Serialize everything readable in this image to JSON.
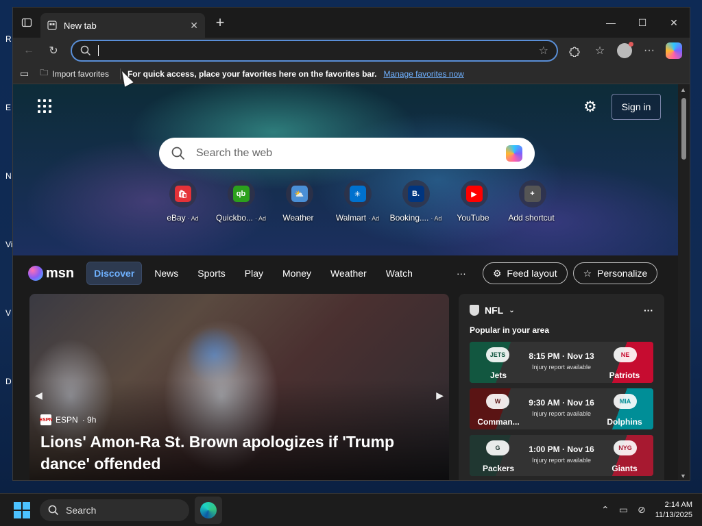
{
  "desktop": {
    "side_letters": [
      "R",
      "E",
      "N",
      "Vis",
      "V",
      "D"
    ]
  },
  "tab": {
    "title": "New tab",
    "close": "✕"
  },
  "window_controls": {
    "minimize": "—",
    "maximize": "☐",
    "close": "✕"
  },
  "address_bar": {
    "value": "",
    "placeholder": ""
  },
  "favorites_bar": {
    "import_label": "Import favorites",
    "message": "For quick access, place your favorites here on the favorites bar.",
    "manage_link": "Manage favorites now"
  },
  "ntp": {
    "signin_label": "Sign in",
    "search_placeholder": "Search the web",
    "shortcuts": [
      {
        "label": "eBay",
        "ad": "· Ad",
        "icon": "ebay-icon",
        "color": "#e53238",
        "glyph": "🛍"
      },
      {
        "label": "Quickbo...",
        "ad": "· Ad",
        "icon": "quickbooks-icon",
        "color": "#2ca01c",
        "glyph": "qb"
      },
      {
        "label": "Weather",
        "ad": "",
        "icon": "weather-icon",
        "color": "#4a8fd6",
        "glyph": "⛅"
      },
      {
        "label": "Walmart",
        "ad": "· Ad",
        "icon": "walmart-icon",
        "color": "#0071ce",
        "glyph": "✳"
      },
      {
        "label": "Booking....",
        "ad": "· Ad",
        "icon": "booking-icon",
        "color": "#003580",
        "glyph": "B."
      },
      {
        "label": "YouTube",
        "ad": "",
        "icon": "youtube-icon",
        "color": "#ff0000",
        "glyph": "▶"
      },
      {
        "label": "Add shortcut",
        "ad": "",
        "icon": "plus-icon",
        "color": "#555555",
        "glyph": "+"
      }
    ]
  },
  "msn": {
    "logo_text": "msn",
    "nav": [
      "Discover",
      "News",
      "Sports",
      "Play",
      "Money",
      "Weather",
      "Watch"
    ],
    "more": "···",
    "feed_layout_label": "Feed layout",
    "personalize_label": "Personalize"
  },
  "hero": {
    "source": "ESPN",
    "age": "· 9h",
    "headline": "Lions' Amon-Ra St. Brown apologizes if 'Trump dance' offended"
  },
  "nfl_card": {
    "league": "NFL",
    "subtitle": "Popular in your area",
    "games": [
      {
        "home": "Jets",
        "away": "Patriots",
        "time": "8:15 PM · Nov 13",
        "note": "Injury report available",
        "home_color": "#125740",
        "away_color": "#c60c30",
        "home_logo": "JETS",
        "away_logo": "NE"
      },
      {
        "home": "Comman...",
        "away": "Dolphins",
        "time": "9:30 AM · Nov 16",
        "note": "Injury report available",
        "home_color": "#5a1414",
        "away_color": "#008e97",
        "home_logo": "W",
        "away_logo": "MIA"
      },
      {
        "home": "Packers",
        "away": "Giants",
        "time": "1:00 PM · Nov 16",
        "note": "Injury report available",
        "home_color": "#203731",
        "away_color": "#a71930",
        "home_logo": "G",
        "away_logo": "NYG"
      }
    ]
  },
  "taskbar": {
    "search_label": "Search",
    "time": "2:14 AM",
    "date": "11/13/2025"
  }
}
